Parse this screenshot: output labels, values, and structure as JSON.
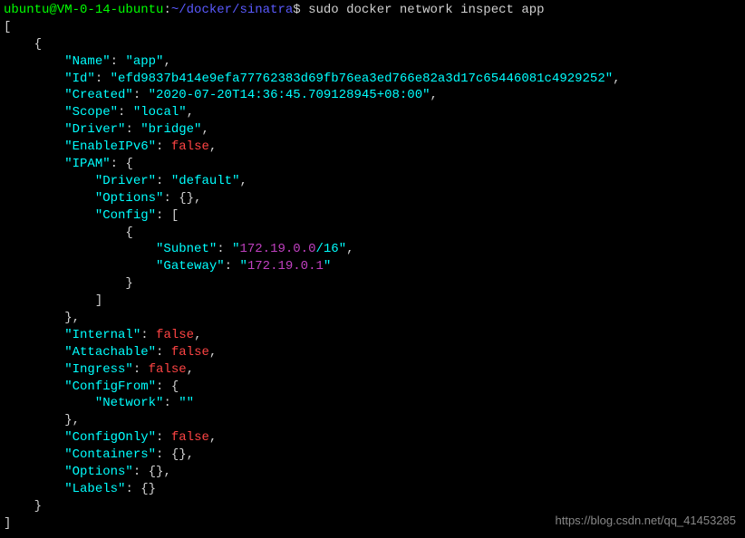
{
  "prompt": {
    "user_host": "ubuntu@VM-0-14-ubuntu",
    "sep1": ":",
    "path": "~/docker/sinatra",
    "sep2": "$ ",
    "command": "sudo docker network inspect app"
  },
  "json": {
    "name_key": "\"Name\"",
    "name_val": "\"app\"",
    "id_key": "\"Id\"",
    "id_val": "\"efd9837b414e9efa77762383d69fb76ea3ed766e82a3d17c65446081c4929252\"",
    "created_key": "\"Created\"",
    "created_val": "\"2020-07-20T14:36:45.709128945+08:00\"",
    "scope_key": "\"Scope\"",
    "scope_val": "\"local\"",
    "driver_key": "\"Driver\"",
    "driver_val": "\"bridge\"",
    "enableipv6_key": "\"EnableIPv6\"",
    "false_val": "false",
    "ipam_key": "\"IPAM\"",
    "ipam_driver_key": "\"Driver\"",
    "ipam_driver_val": "\"default\"",
    "ipam_options_key": "\"Options\"",
    "ipam_config_key": "\"Config\"",
    "subnet_key": "\"Subnet\"",
    "subnet_quote": "\"",
    "subnet_ip": "172.19.0.0",
    "subnet_suffix": "/16\"",
    "gateway_key": "\"Gateway\"",
    "gateway_quote": "\"",
    "gateway_ip": "172.19.0.1",
    "gateway_end": "\"",
    "internal_key": "\"Internal\"",
    "attachable_key": "\"Attachable\"",
    "ingress_key": "\"Ingress\"",
    "configfrom_key": "\"ConfigFrom\"",
    "network_key": "\"Network\"",
    "network_val": "\"\"",
    "configonly_key": "\"ConfigOnly\"",
    "containers_key": "\"Containers\"",
    "options_key": "\"Options\"",
    "labels_key": "\"Labels\""
  },
  "watermark": "https://blog.csdn.net/qq_41453285"
}
